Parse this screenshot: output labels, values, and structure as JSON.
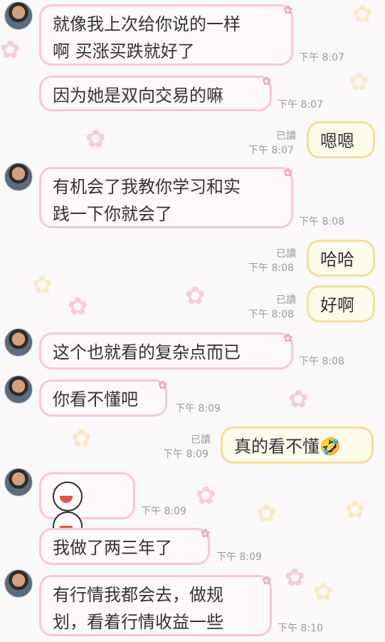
{
  "messages": [
    {
      "side": "left",
      "text": "就像我上次给你说的一样\n啊  买涨买跌就好了",
      "time": "下午 8:07"
    },
    {
      "side": "left",
      "text": "因为她是双向交易的嘛",
      "time": "下午 8:07"
    },
    {
      "side": "right",
      "text": "嗯嗯",
      "read": "已讀",
      "time": "下午 8:07"
    },
    {
      "side": "left",
      "text": "有机会了我教你学习和实\n践一下你就会了",
      "time": "下午 8:08"
    },
    {
      "side": "right",
      "text": "哈哈",
      "read": "已讀",
      "time": "下午 8:08"
    },
    {
      "side": "right",
      "text": "好啊",
      "read": "已讀",
      "time": "下午 8:08"
    },
    {
      "side": "left",
      "text": "这个也就看的复杂点而已",
      "time": "下午 8:08"
    },
    {
      "side": "left",
      "text": "你看不懂吧",
      "time": "下午 8:09"
    },
    {
      "side": "right",
      "text": "真的看不懂🤣",
      "read": "已讀",
      "time": "下午 8:09"
    },
    {
      "side": "left",
      "text": "",
      "emoji": "laughing-faces",
      "time": "下午 8:09"
    },
    {
      "side": "left",
      "text": "我做了两三年了",
      "time": "下午 8:09"
    },
    {
      "side": "left",
      "text": "有行情我都会去，做规\n划，看着行情收益一些",
      "time": "下午 8:10"
    }
  ],
  "colors": {
    "left_border": "#f6c8d6",
    "right_border": "#f3df9a",
    "time_text": "#9a9a9a"
  }
}
